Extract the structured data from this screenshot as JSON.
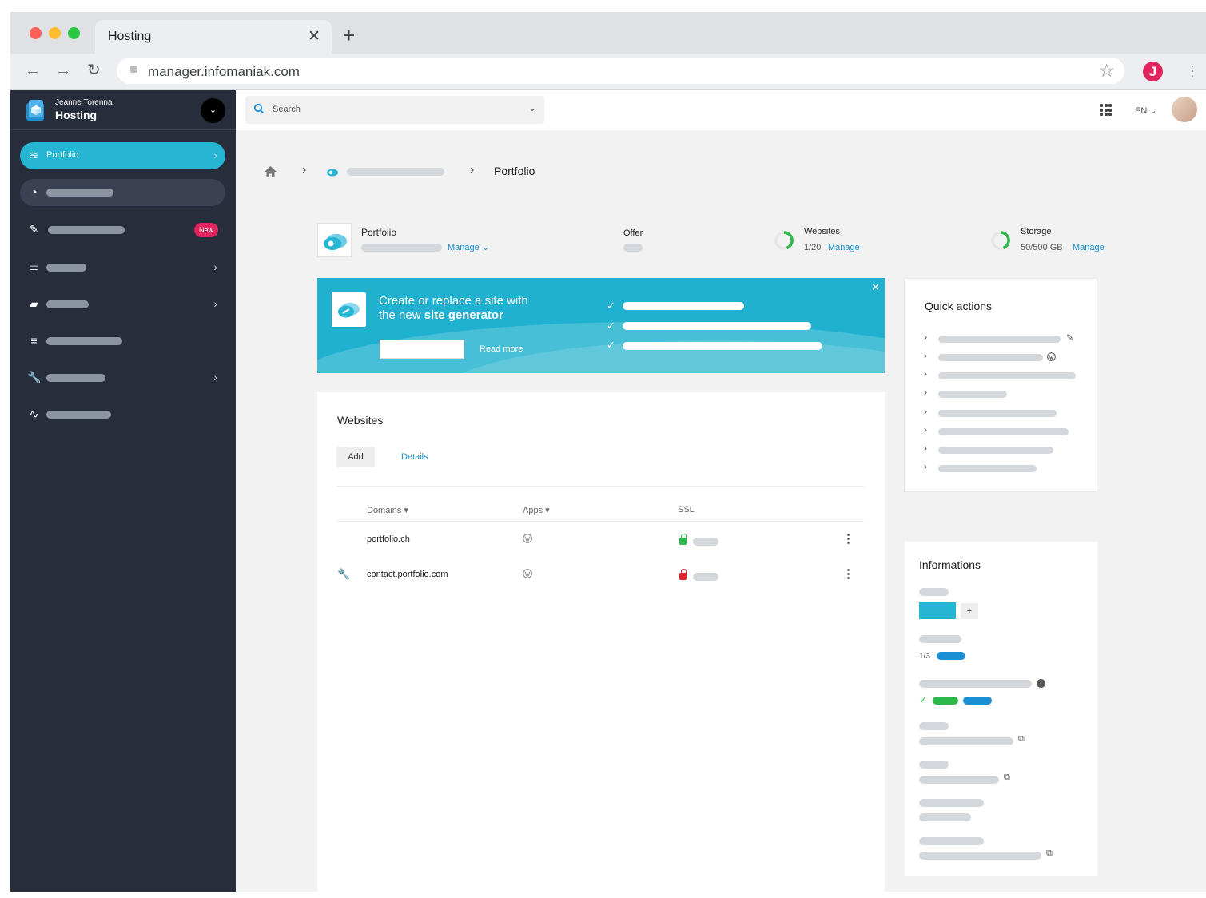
{
  "browser": {
    "tab_title": "Hosting",
    "url": "manager.infomaniak.com",
    "profile_initial": "J",
    "colors": {
      "close": "#ff5f57",
      "minimize": "#ffbd2e",
      "zoom": "#28c840"
    }
  },
  "sidebar": {
    "user_name": "Jeanne Torenna",
    "app_name": "Hosting",
    "items": [
      {
        "label": "Portfolio",
        "icon": "layers-icon",
        "active": true
      },
      {
        "label": "",
        "icon": "dashboard-icon"
      },
      {
        "label": "",
        "icon": "edit-icon",
        "badge": "New"
      },
      {
        "label": "",
        "icon": "window-icon"
      },
      {
        "label": "",
        "icon": "folder-icon"
      },
      {
        "label": "",
        "icon": "database-icon"
      },
      {
        "label": "",
        "icon": "wrench-icon"
      },
      {
        "label": "",
        "icon": "activity-icon"
      }
    ]
  },
  "topbar": {
    "search_placeholder": "Search",
    "language": "EN"
  },
  "breadcrumb": {
    "current": "Portfolio"
  },
  "summary": {
    "portfolio_title": "Portfolio",
    "manage_label": "Manage",
    "offer_label": "Offer",
    "websites_label": "Websites",
    "websites_value": "1/20",
    "websites_manage": "Manage",
    "storage_label": "Storage",
    "storage_value": "50/500 GB",
    "storage_manage": "Manage"
  },
  "banner": {
    "line1": "Create or replace a site with",
    "line2_prefix": "the new ",
    "line2_bold": "site generator",
    "read_more": "Read more"
  },
  "websites": {
    "title": "Websites",
    "add_label": "Add",
    "details_label": "Details",
    "columns": {
      "domains": "Domains",
      "apps": "Apps",
      "ssl": "SSL"
    },
    "rows": [
      {
        "domain": "portfolio.ch",
        "ssl_status": "valid",
        "warning": false
      },
      {
        "domain": "contact.portfolio.com",
        "ssl_status": "invalid",
        "warning": true
      }
    ]
  },
  "quick_actions": {
    "title": "Quick actions"
  },
  "informations": {
    "title": "Informations",
    "add_label": "+",
    "fraction": "1/3"
  }
}
